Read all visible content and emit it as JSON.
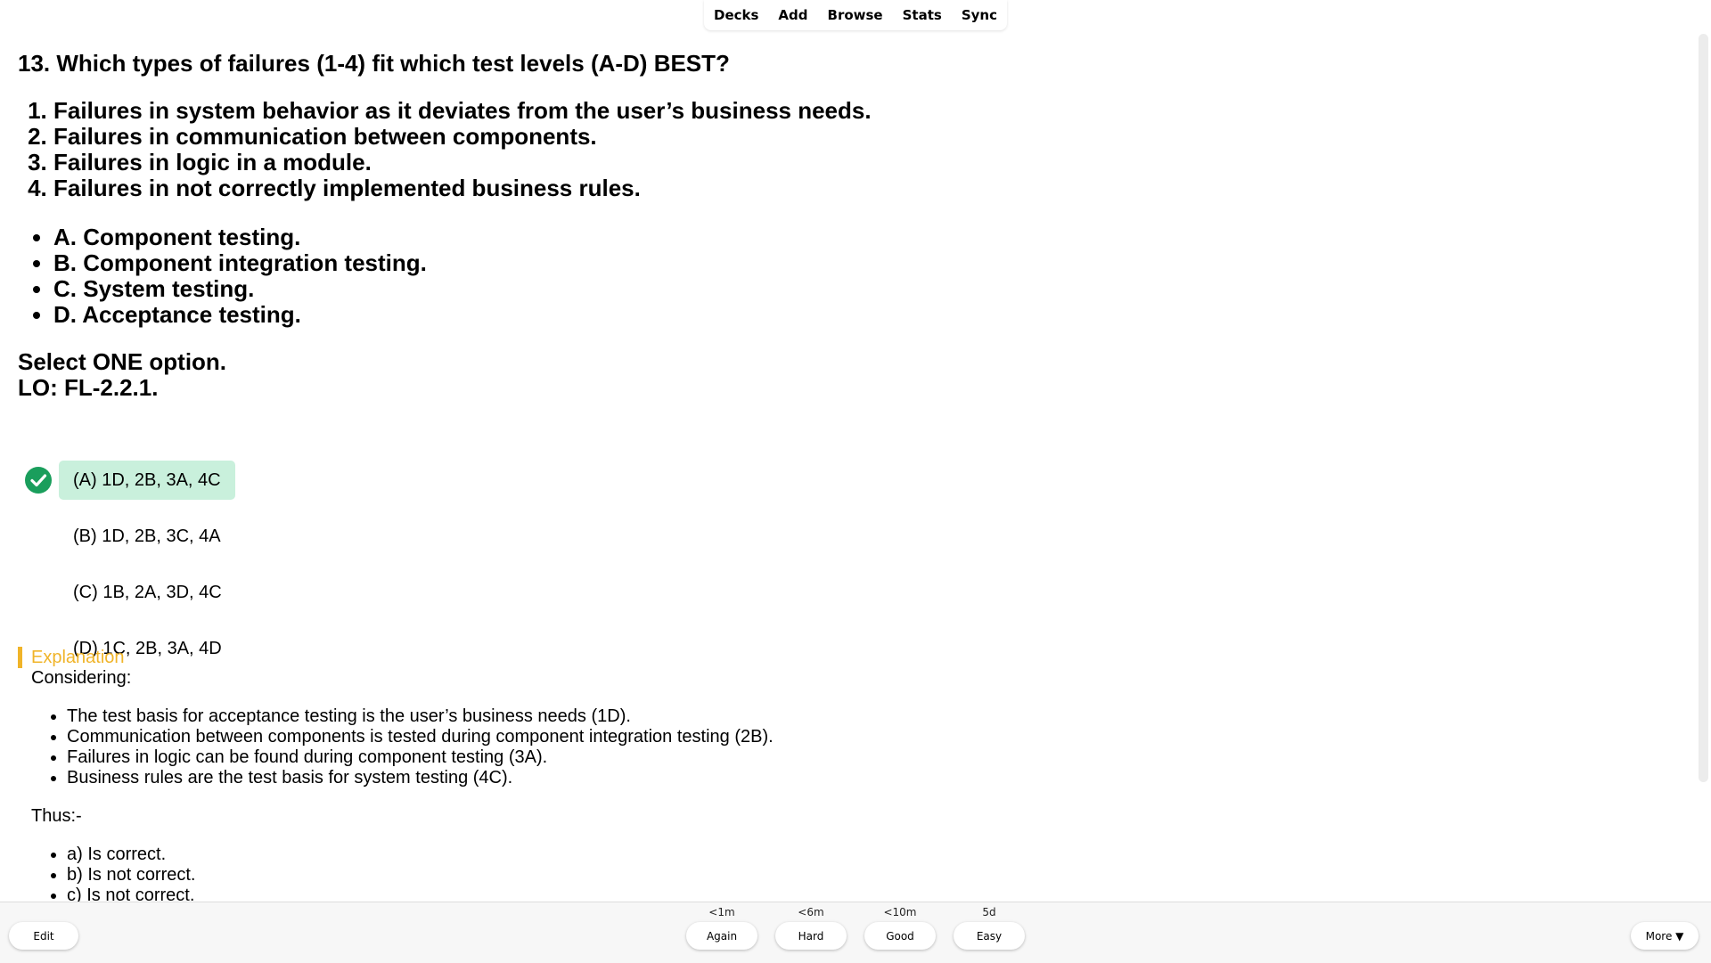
{
  "nav": {
    "items": [
      "Decks",
      "Add",
      "Browse",
      "Stats",
      "Sync"
    ]
  },
  "question": {
    "title": "13. Which types of failures (1-4) fit which test levels (A-D) BEST?",
    "failures": [
      "Failures in system behavior as it deviates from the user’s business needs.",
      "Failures in communication between components.",
      "Failures in logic in a module.",
      "Failures in not correctly implemented business rules."
    ],
    "levels": [
      "A. Component testing.",
      "B. Component integration testing.",
      "C. System testing.",
      "D. Acceptance testing."
    ],
    "instruction": "Select ONE option.",
    "lo": "LO: FL-2.2.1."
  },
  "options": [
    {
      "label": "(A) 1D, 2B, 3A, 4C",
      "correct": true
    },
    {
      "label": "(B) 1D, 2B, 3C, 4A",
      "correct": false
    },
    {
      "label": "(C) 1B, 2A, 3D, 4C",
      "correct": false
    },
    {
      "label": "(D) 1C, 2B, 3A, 4D",
      "correct": false
    }
  ],
  "explanation": {
    "title": "Explanation",
    "intro": "Considering:",
    "points": [
      "The test basis for acceptance testing is the user’s business needs (1D).",
      "Communication between components is tested during component integration testing (2B).",
      "Failures in logic can be found during component testing (3A).",
      "Business rules are the test basis for system testing (4C)."
    ],
    "thus": "Thus:-",
    "verdicts": [
      "a) Is correct.",
      "b) Is not correct.",
      "c) Is not correct."
    ]
  },
  "bottom": {
    "edit": "Edit",
    "answers": [
      {
        "timing": "<1m",
        "label": "Again"
      },
      {
        "timing": "<6m",
        "label": "Hard"
      },
      {
        "timing": "<10m",
        "label": "Good"
      },
      {
        "timing": "5d",
        "label": "Easy"
      }
    ],
    "more": "More ▼"
  },
  "colors": {
    "correct_bg": "#c9f0dc",
    "check_green": "#1a9e5c",
    "explanation_accent": "#f0b429"
  }
}
